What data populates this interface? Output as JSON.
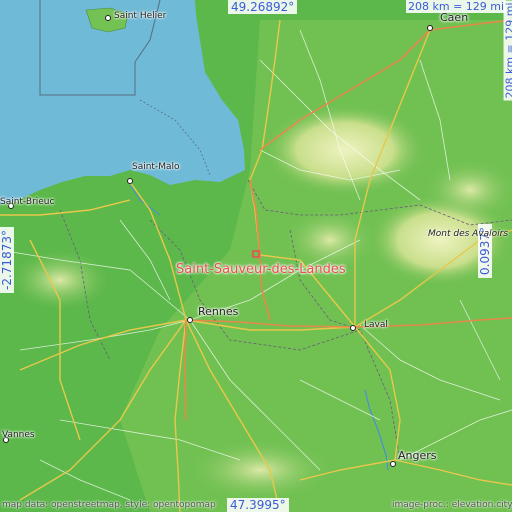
{
  "coordinates": {
    "north": "49.26892°",
    "south": "47.3995°",
    "west": "-2.71873°",
    "east": "0.0937°"
  },
  "scale": {
    "horizontal": "208 km = 129 mi",
    "vertical": "208 km = 129 mi"
  },
  "highlight_place": "Saint-Sauveur-des-Landes",
  "cities": {
    "saint_helier": "Saint Helier",
    "caen": "Caen",
    "saint_malo": "Saint-Malo",
    "saint_brieuc": "Saint-Brieuc",
    "rennes": "Rennes",
    "laval": "Laval",
    "vannes": "Vannes",
    "angers": "Angers"
  },
  "mountain": "Mont des Avaloirs",
  "attribution_left": "map data: openstreetmap, style: opentopomap",
  "attribution_right": "image-proc.: elevation.city",
  "colors": {
    "sea": "#6fbad6",
    "lowland": "#5cb84a",
    "upland": "#d9e7a0",
    "road_major": "#e8c84a",
    "road_highway": "#e58a4a",
    "highlight": "#e8504e",
    "coord_text": "#3b5bd6"
  }
}
